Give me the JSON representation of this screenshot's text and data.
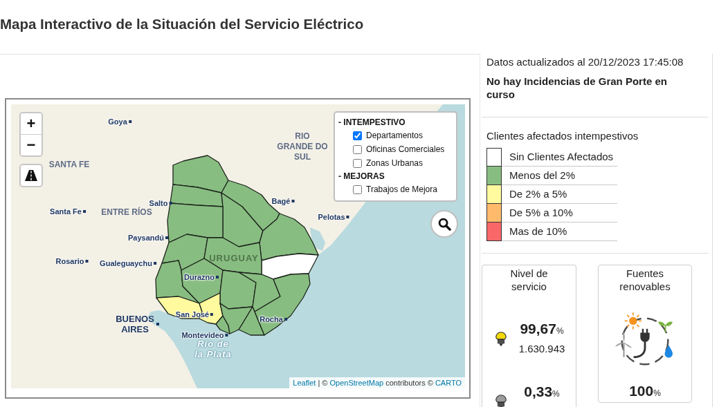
{
  "page": {
    "title": "Mapa Interactivo de la Situación del Servicio Eléctrico"
  },
  "map": {
    "zoom_in": "+",
    "zoom_out": "−",
    "layers": [
      {
        "title": "- INTEMPESTIVO",
        "items": [
          {
            "label": "Departamentos",
            "checked": true
          },
          {
            "label": "Oficinas Comerciales",
            "checked": false
          },
          {
            "label": "Zonas Urbanas",
            "checked": false
          }
        ]
      },
      {
        "title": "- MEJORAS",
        "items": [
          {
            "label": "Trabajos de Mejora",
            "checked": false
          }
        ]
      }
    ],
    "departments": [
      {
        "color": "#88bd81"
      },
      {
        "color": "#88bd81"
      },
      {
        "color": "#88bd81"
      },
      {
        "color": "#88bd81"
      },
      {
        "color": "#88bd81"
      },
      {
        "color": "#ffffff"
      },
      {
        "color": "#88bd81"
      },
      {
        "color": "#88bd81"
      },
      {
        "color": "#88bd81"
      },
      {
        "color": "#88bd81"
      },
      {
        "color": "#88bd81"
      },
      {
        "color": "#88bd81"
      },
      {
        "color": "#fffa9e"
      },
      {
        "color": "#fffa9e"
      },
      {
        "color": "#88bd81"
      },
      {
        "color": "#88bd81"
      },
      {
        "color": "#88bd81"
      },
      {
        "color": "#88bd81"
      },
      {
        "color": "#88bd81"
      }
    ],
    "labels": [
      {
        "text": "Goya",
        "kind": "city"
      },
      {
        "text": "RIO GRANDE DO SUL",
        "kind": "region"
      },
      {
        "text": "SANTA FE",
        "kind": "region"
      },
      {
        "text": "Bagé",
        "kind": "city"
      },
      {
        "text": "Salto",
        "kind": "city"
      },
      {
        "text": "Santa Fe",
        "kind": "city"
      },
      {
        "text": "ENTRE RÍOS",
        "kind": "region"
      },
      {
        "text": "Pelotas",
        "kind": "city"
      },
      {
        "text": "Paysandú",
        "kind": "city"
      },
      {
        "text": "URUGUAY",
        "kind": "country"
      },
      {
        "text": "Rosario",
        "kind": "city"
      },
      {
        "text": "Gualeguaychu",
        "kind": "city"
      },
      {
        "text": "Durazno",
        "kind": "city"
      },
      {
        "text": "San José",
        "kind": "city"
      },
      {
        "text": "Rocha",
        "kind": "city"
      },
      {
        "text": "BUENOS AIRES",
        "kind": "capital"
      },
      {
        "text": "Montevideo",
        "kind": "city"
      },
      {
        "text": "Río de la Plata",
        "kind": "water"
      }
    ],
    "attribution": [
      {
        "text": "Leaflet",
        "kind": "link"
      },
      {
        "text": "| ©",
        "kind": "text"
      },
      {
        "text": "OpenStreetMap",
        "kind": "link"
      },
      {
        "text": "contributors ©",
        "kind": "text"
      },
      {
        "text": "CARTO",
        "kind": "link"
      }
    ]
  },
  "status": {
    "updated": "Datos actualizados al 20/12/2023 17:45:08",
    "incidents": "No hay Incidencias de Gran Porte en curso"
  },
  "legend": {
    "title": "Clientes afectados intempestivos",
    "items": [
      {
        "label": "Sin Clientes Afectados",
        "color": "#ffffff"
      },
      {
        "label": "Menos del 2%",
        "color": "#88bd81"
      },
      {
        "label": "De 2% a 5%",
        "color": "#fffa9e"
      },
      {
        "label": "De 5% a 10%",
        "color": "#ffbb6b"
      },
      {
        "label": "Mas de 10%",
        "color": "#f86868"
      }
    ]
  },
  "service_card": {
    "title": "Nivel de servicio",
    "rows": [
      {
        "kind": "on",
        "value": "99,67",
        "unit": "%",
        "count": "1.630.943"
      },
      {
        "kind": "off",
        "value": "0,33",
        "unit": "%"
      }
    ]
  },
  "renewables_card": {
    "title": "Fuentes renovables",
    "value": "100",
    "unit": "%"
  }
}
